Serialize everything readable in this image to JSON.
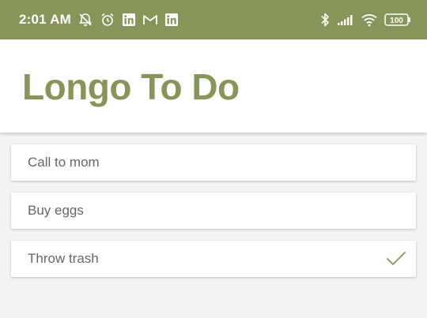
{
  "status_bar": {
    "time": "2:01 AM",
    "left_icons": [
      "notifications-off-icon",
      "alarm-icon",
      "linkedin-icon",
      "gmail-icon",
      "linkedin-icon"
    ],
    "right_icons": [
      "bluetooth-icon",
      "signal-icon",
      "wifi-icon",
      "battery-icon"
    ],
    "battery_level": "100",
    "background": "#879558"
  },
  "header": {
    "title": "Longo To Do",
    "accent_color": "#879558"
  },
  "todos": [
    {
      "text": "Call to mom",
      "done": false
    },
    {
      "text": "Buy eggs",
      "done": false
    },
    {
      "text": "Throw trash",
      "done": true
    }
  ]
}
